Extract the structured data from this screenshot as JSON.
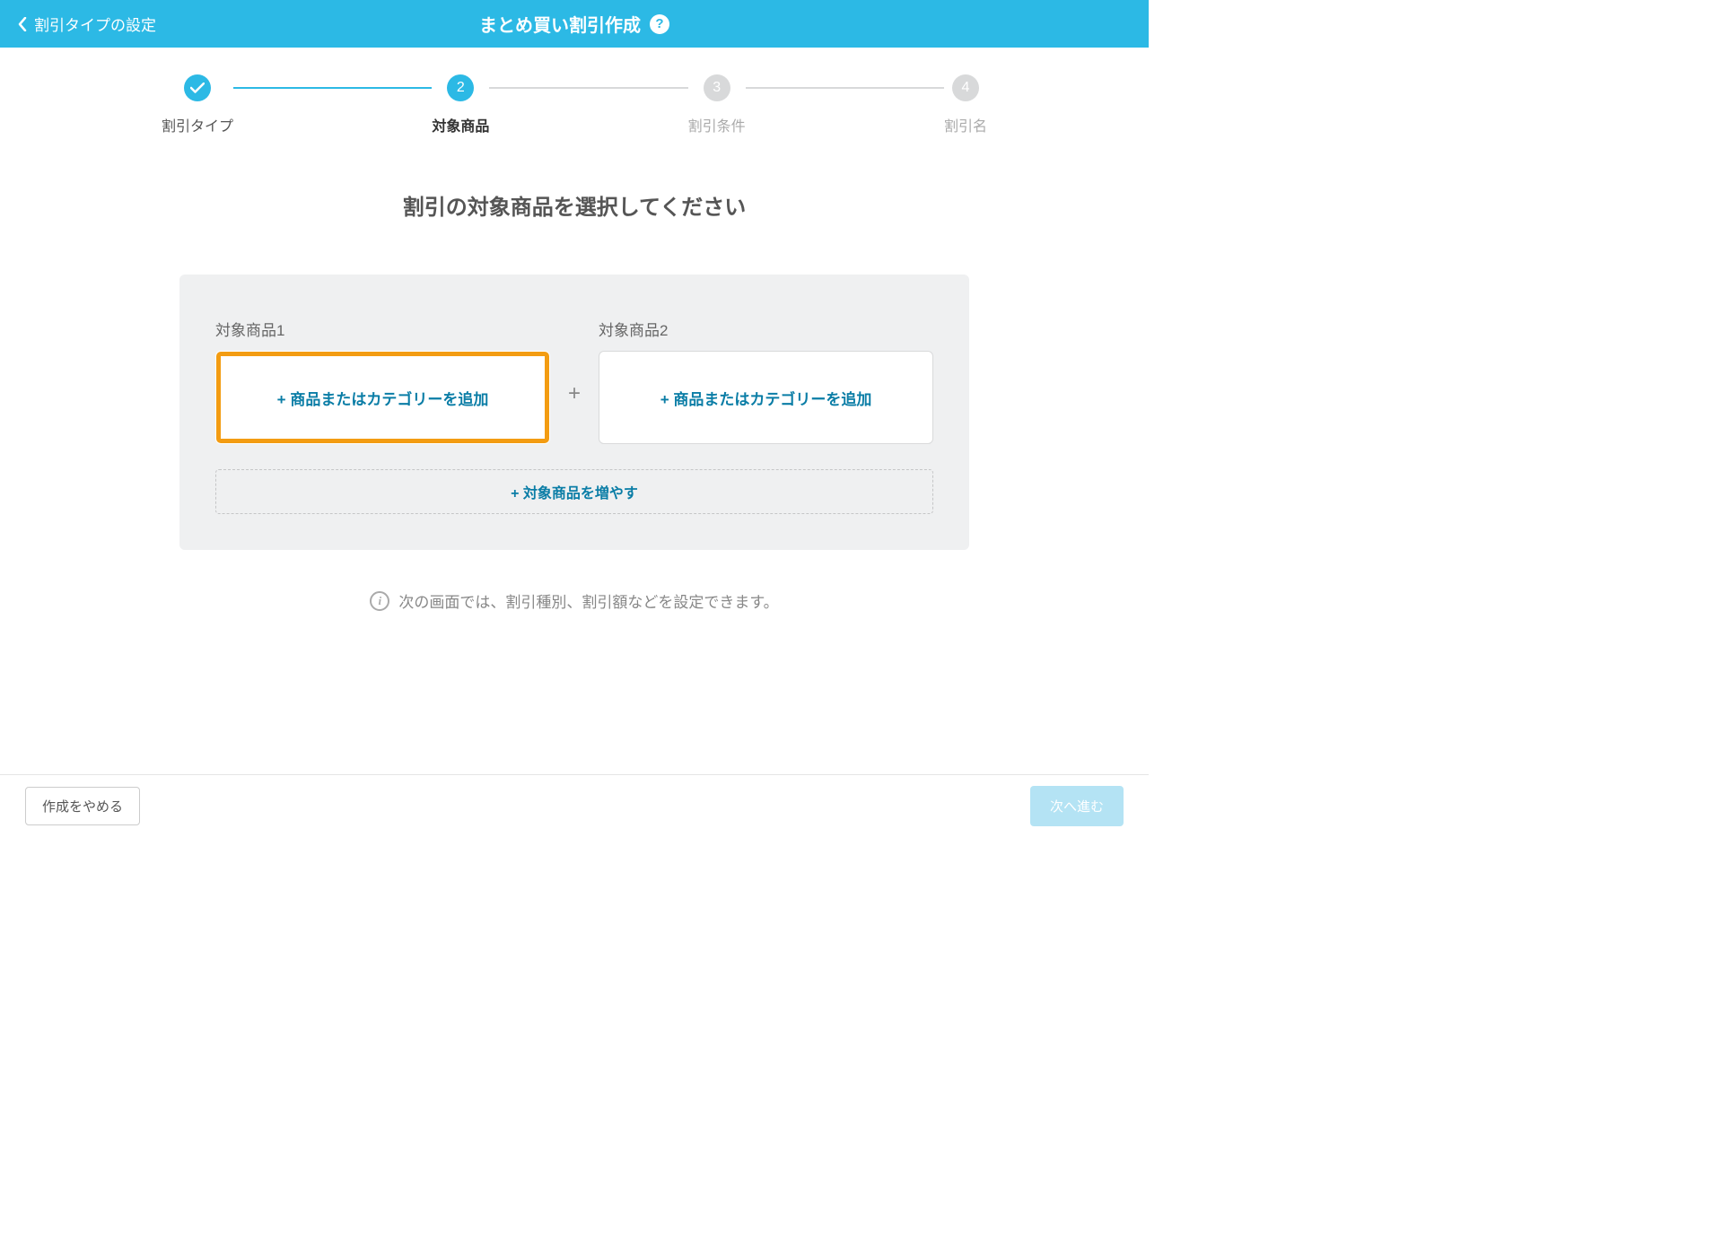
{
  "header": {
    "back_label": "割引タイプの設定",
    "title": "まとめ買い割引作成",
    "help_glyph": "?"
  },
  "stepper": {
    "steps": [
      {
        "label": "割引タイプ",
        "state": "done",
        "number": ""
      },
      {
        "label": "対象商品",
        "state": "current",
        "number": "2"
      },
      {
        "label": "割引条件",
        "state": "pending",
        "number": "3"
      },
      {
        "label": "割引名",
        "state": "pending",
        "number": "4"
      }
    ]
  },
  "main": {
    "title": "割引の対象商品を選択してください"
  },
  "panel": {
    "blocks": [
      {
        "label": "対象商品1",
        "button_label": "+ 商品またはカテゴリーを追加",
        "highlighted": true
      },
      {
        "label": "対象商品2",
        "button_label": "+ 商品またはカテゴリーを追加",
        "highlighted": false
      }
    ],
    "plus_separator": "+",
    "add_more_label": "+ 対象商品を増やす"
  },
  "info": {
    "text": "次の画面では、割引種別、割引額などを設定できます。"
  },
  "footer": {
    "cancel_label": "作成をやめる",
    "next_label": "次へ進む"
  }
}
